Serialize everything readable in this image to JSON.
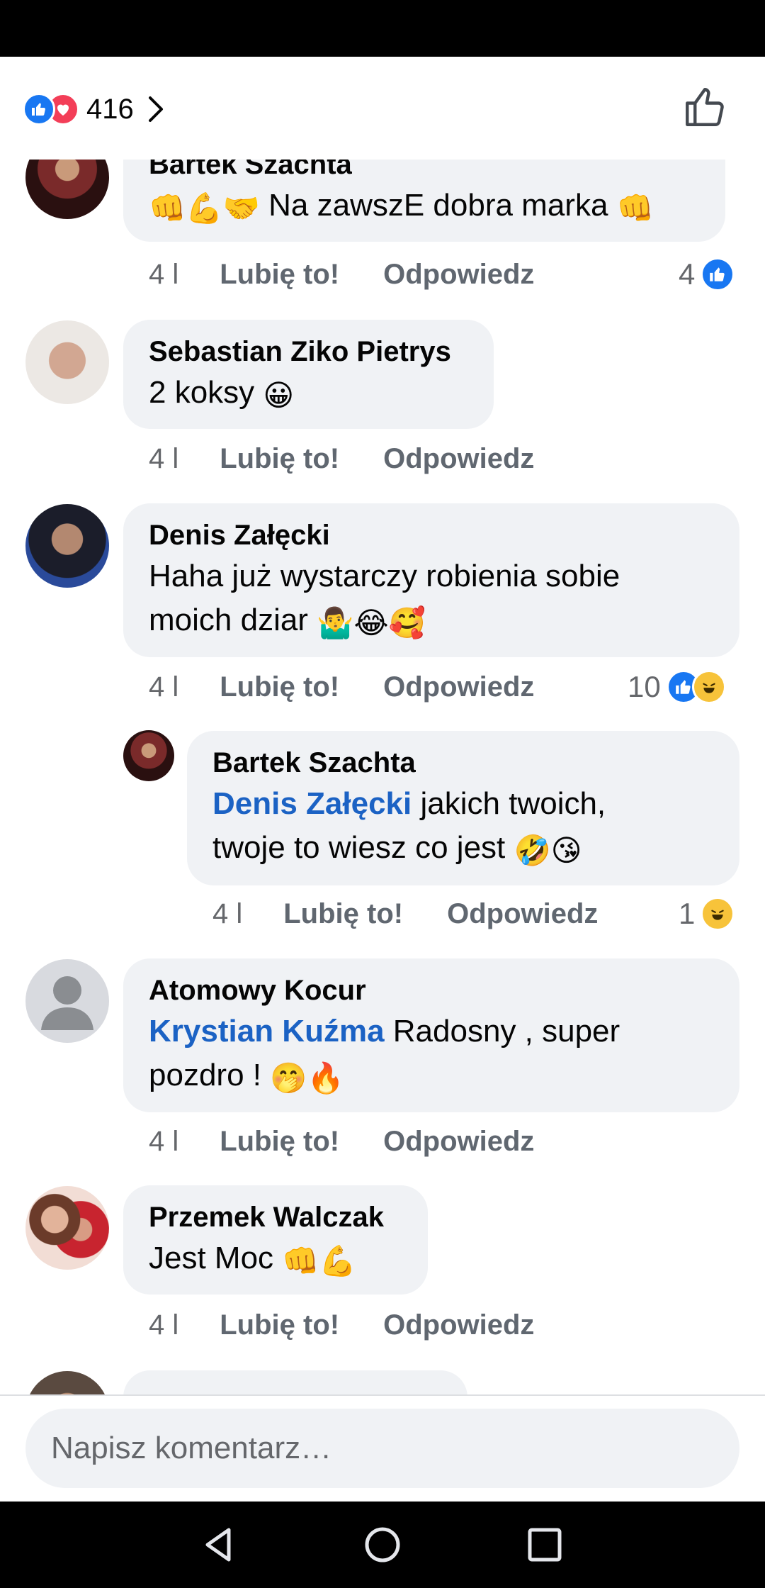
{
  "header": {
    "reaction_count": "416",
    "reaction_icons": [
      "like-icon",
      "love-icon"
    ]
  },
  "comments": [
    {
      "author": "Bartek Szachta",
      "text": "Na zawszE dobra marka",
      "emoji_before": "👊💪🤝",
      "emoji_after": "👊",
      "age": "4 l",
      "like_label": "Lubię to!",
      "reply_label": "Odpowiedz",
      "reactions": "4"
    },
    {
      "author": "Sebastian Ziko Pietrys",
      "text": "2 koksy",
      "emoji_after": "😀",
      "age": "4 l",
      "like_label": "Lubię to!",
      "reply_label": "Odpowiedz"
    },
    {
      "author": "Denis Załęcki",
      "text_line1": "Haha już wystarczy robienia sobie",
      "text_line2": "moich dziar",
      "emoji_after": "🤷‍♂️😂🥰",
      "age": "4 l",
      "like_label": "Lubię to!",
      "reply_label": "Odpowiedz",
      "reactions": "10"
    },
    {
      "author": "Bartek Szachta",
      "mention": "Denis Załęcki",
      "text_line1": "jakich twoich,",
      "text_line2": "twoje to wiesz co jest",
      "emoji_after": "🤣😘",
      "age": "4 l",
      "like_label": "Lubię to!",
      "reply_label": "Odpowiedz",
      "reactions": "1"
    },
    {
      "author": "Atomowy Kocur",
      "mention": "Krystian Kuźma",
      "text_line1": "Radosny , super",
      "text_line2": "pozdro !",
      "emoji_after": "🤭🔥",
      "age": "4 l",
      "like_label": "Lubię to!",
      "reply_label": "Odpowiedz"
    },
    {
      "author": "Przemek Walczak",
      "text": "Jest Moc",
      "emoji_after": "👊💪",
      "age": "4 l",
      "like_label": "Lubię to!",
      "reply_label": "Odpowiedz"
    }
  ],
  "composer": {
    "placeholder": "Napisz komentarz…"
  },
  "colors": {
    "like_blue": "#1877f2",
    "love_red": "#f33e58",
    "mention_blue": "#1b62c4",
    "bubble_gray": "#f0f2f5"
  }
}
